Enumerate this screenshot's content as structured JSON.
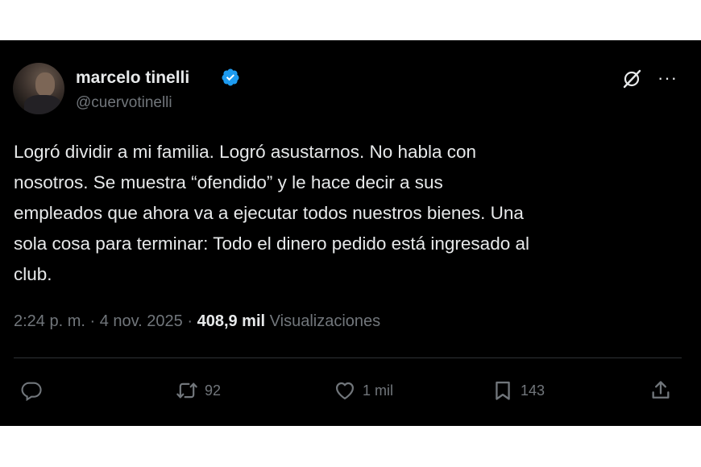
{
  "tweet": {
    "author_name": "marcelo tinelli",
    "handle": "@cuervotinelli",
    "text": "Logró dividir a mi familia. Logró asustarnos. No habla con\nnosotros. Se muestra “ofendido” y le hace decir a sus\nempleados que ahora va a ejecutar todos nuestros bienes. Una\nsola cosa para terminar: Todo el dinero pedido está ingresado al\nclub.",
    "time": "2:24 p. m.",
    "date": "4 nov. 2025",
    "separator": "·",
    "views_count": "408,9 mil",
    "views_label": "Visualizaciones"
  },
  "actions": {
    "reply_count": "",
    "retweet_count": "92",
    "like_count": "1 mil",
    "bookmark_count": "143"
  },
  "icons": {
    "verified": "verified-badge-icon",
    "grok": "grok-icon",
    "more": "more-icon",
    "reply": "reply-icon",
    "retweet": "retweet-icon",
    "like": "heart-icon",
    "bookmark": "bookmark-icon",
    "share": "share-icon"
  },
  "colors": {
    "background": "#000000",
    "text": "#e7e9ea",
    "muted": "#71767b",
    "verified": "#1d9bf0",
    "divider": "#2f3336"
  }
}
